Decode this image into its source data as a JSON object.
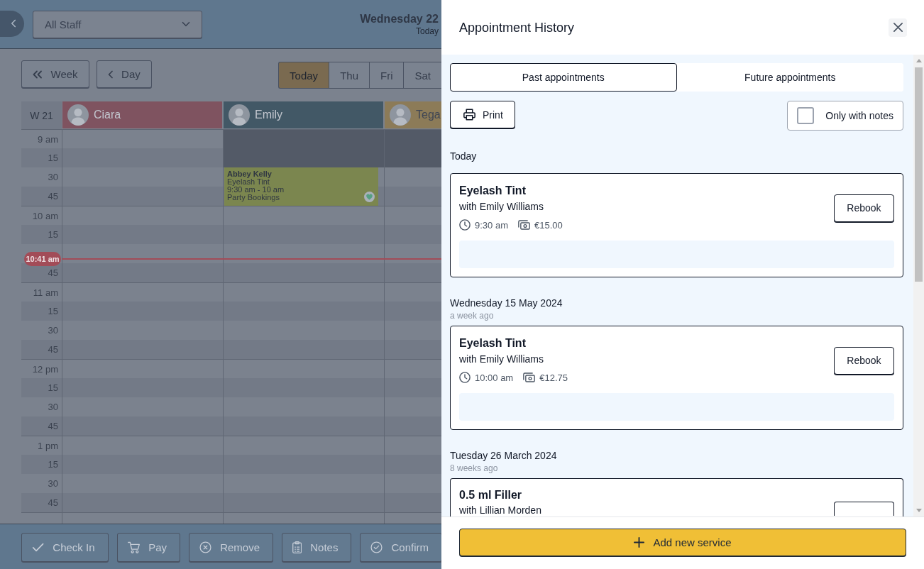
{
  "topbar": {
    "staff_filter": {
      "value": "All Staff"
    },
    "date": {
      "title": "Wednesday 22",
      "subtitle": "Today"
    }
  },
  "navigation": {
    "buttons": [
      {
        "label": "Week",
        "kind": "week"
      },
      {
        "label": "Day",
        "kind": "day"
      }
    ],
    "day_tabs": [
      {
        "label": "Today",
        "selected": true
      },
      {
        "label": "Thu",
        "selected": false
      },
      {
        "label": "Fri",
        "selected": false
      },
      {
        "label": "Sat",
        "selected": false
      }
    ]
  },
  "calendar": {
    "week": "W 21",
    "staff": [
      {
        "name": "Ciara",
        "color": "#7f5360"
      },
      {
        "name": "Emily",
        "color": "#425866"
      },
      {
        "name": "Tega",
        "color": "#8c7b58"
      }
    ],
    "slots": [
      {
        "label": "9 am",
        "kind": "hour",
        "cells": [
          {
            "blocked": false
          },
          {
            "blocked": true
          },
          {
            "blocked": true
          }
        ]
      },
      {
        "label": "15",
        "kind": "quarter",
        "cells": [
          {
            "blocked": false
          },
          {
            "blocked": true
          },
          {
            "blocked": true
          }
        ]
      },
      {
        "label": "30",
        "kind": "quarter",
        "cells": [
          {
            "blocked": false
          },
          {
            "blocked": false,
            "booking": {
              "client": "Abbey Kelly",
              "service": "Eyelash Tint",
              "time": "9:30 am - 10 am",
              "source": "Party Bookings"
            }
          },
          {
            "blocked": false
          }
        ]
      },
      {
        "label": "45",
        "kind": "quarter",
        "cells": [
          {
            "blocked": false
          },
          {
            "blocked": false
          }
        ]
      },
      {
        "label": "10 am",
        "kind": "hour",
        "cells": [
          {
            "blocked": false
          },
          {
            "blocked": false
          },
          {
            "blocked": false
          }
        ]
      },
      {
        "label": "15",
        "kind": "quarter",
        "cells": [
          {
            "blocked": false
          },
          {
            "blocked": false
          },
          {
            "blocked": false
          }
        ]
      },
      {
        "kind": "quarter",
        "now": {
          "label": "10:41 am"
        },
        "cells": [
          {
            "blocked": false
          },
          {
            "blocked": false
          },
          {
            "blocked": false
          }
        ]
      },
      {
        "label": "45",
        "kind": "quarter",
        "cells": [
          {
            "blocked": false
          },
          {
            "blocked": false
          },
          {
            "blocked": false
          }
        ]
      },
      {
        "label": "11 am",
        "kind": "hour",
        "cells": [
          {
            "blocked": false
          },
          {
            "blocked": false
          },
          {
            "blocked": false
          }
        ]
      },
      {
        "label": "15",
        "kind": "quarter",
        "cells": [
          {
            "blocked": false
          },
          {
            "blocked": false
          },
          {
            "blocked": false
          }
        ]
      },
      {
        "label": "30",
        "kind": "quarter",
        "cells": [
          {
            "blocked": false
          },
          {
            "blocked": false
          },
          {
            "blocked": false
          }
        ]
      },
      {
        "label": "45",
        "kind": "quarter",
        "cells": [
          {
            "blocked": false
          },
          {
            "blocked": false
          },
          {
            "blocked": false
          }
        ]
      },
      {
        "label": "12 pm",
        "kind": "hour",
        "cells": [
          {
            "blocked": false
          },
          {
            "blocked": false
          },
          {
            "blocked": false
          }
        ]
      },
      {
        "label": "15",
        "kind": "quarter",
        "cells": [
          {
            "blocked": false
          },
          {
            "blocked": false
          },
          {
            "blocked": false
          }
        ]
      },
      {
        "label": "30",
        "kind": "quarter",
        "cells": [
          {
            "blocked": false
          },
          {
            "blocked": false
          },
          {
            "blocked": false
          }
        ]
      },
      {
        "label": "45",
        "kind": "quarter",
        "cells": [
          {
            "blocked": false
          },
          {
            "blocked": false
          },
          {
            "blocked": false
          }
        ]
      },
      {
        "label": "1 pm",
        "kind": "hour",
        "cells": [
          {
            "blocked": false
          },
          {
            "blocked": false
          },
          {
            "blocked": false
          }
        ]
      },
      {
        "label": "15",
        "kind": "quarter",
        "cells": [
          {
            "blocked": false
          },
          {
            "blocked": false
          },
          {
            "blocked": false
          }
        ]
      },
      {
        "label": "30",
        "kind": "quarter",
        "cells": [
          {
            "blocked": false
          },
          {
            "blocked": false
          },
          {
            "blocked": false
          }
        ]
      },
      {
        "label": "45",
        "kind": "quarter",
        "cells": [
          {
            "blocked": false
          },
          {
            "blocked": false
          },
          {
            "blocked": false
          }
        ]
      },
      {
        "kind": "hour",
        "cells": [
          {
            "blocked": false
          },
          {
            "blocked": false
          },
          {
            "blocked": false
          }
        ]
      }
    ]
  },
  "actions": [
    {
      "label": "Check In",
      "kind": "check-in",
      "disabled": true
    },
    {
      "label": "Pay",
      "kind": "pay",
      "disabled": true
    },
    {
      "label": "Remove",
      "kind": "remove",
      "disabled": true
    },
    {
      "label": "Notes",
      "kind": "notes",
      "disabled": true
    },
    {
      "label": "Confirm",
      "kind": "confirm",
      "disabled": true
    }
  ],
  "history": {
    "title": "Appointment History",
    "tabs": [
      {
        "label": "Past appointments",
        "selected": true
      },
      {
        "label": "Future appointments",
        "selected": false
      }
    ],
    "print": {
      "label": "Print"
    },
    "notes_filter": {
      "label": "Only with notes",
      "checked": false
    },
    "groups": [
      {
        "date": "Today",
        "appointments": [
          {
            "kind": "full",
            "title": "Eyelash Tint",
            "staff": "with Emily Williams",
            "time": "9:30 am",
            "price": "€15.00",
            "button": "Rebook"
          }
        ]
      },
      {
        "date": "Wednesday 15 May 2024",
        "ago": "a week ago",
        "appointments": [
          {
            "kind": "full",
            "title": "Eyelash Tint",
            "staff": "with Emily Williams",
            "time": "10:00 am",
            "price": "€12.75",
            "button": "Rebook"
          }
        ]
      },
      {
        "date": "Tuesday 26 March 2024",
        "ago": "8 weeks ago",
        "appointments": [
          {
            "kind": "partial",
            "title": "0.5 ml Filler",
            "staff": "with Lillian Morden"
          }
        ]
      }
    ],
    "add_button": {
      "label": "Add new service"
    }
  }
}
